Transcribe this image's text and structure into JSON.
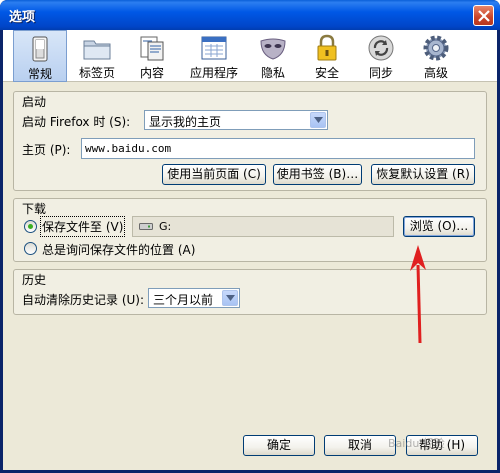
{
  "window": {
    "title": "选项"
  },
  "toolbar": {
    "tabs": [
      {
        "label": "常规",
        "icon": "general-switch-icon"
      },
      {
        "label": "标签页",
        "icon": "tabs-folder-icon"
      },
      {
        "label": "内容",
        "icon": "content-page-icon"
      },
      {
        "label": "应用程序",
        "icon": "applications-window-icon"
      },
      {
        "label": "隐私",
        "icon": "privacy-mask-icon"
      },
      {
        "label": "安全",
        "icon": "security-lock-icon"
      },
      {
        "label": "同步",
        "icon": "sync-arrows-icon"
      },
      {
        "label": "高级",
        "icon": "advanced-gear-icon"
      }
    ],
    "selected": "常规"
  },
  "startup": {
    "group_title": "启动",
    "when_label": "启动 Firefox 时 (S):",
    "when_value": "显示我的主页",
    "homepage_label": "主页 (P):",
    "homepage_value": "www.baidu.com",
    "use_current_btn": "使用当前页面 (C)",
    "use_bookmark_btn": "使用书签 (B)…",
    "restore_default_btn": "恢复默认设置 (R)"
  },
  "downloads": {
    "group_title": "下载",
    "save_to_label": "保存文件至 (V)",
    "save_to_path": "G:",
    "browse_btn": "浏览 (O)…",
    "always_ask_label": "总是询问保存文件的位置 (A)",
    "selected_option": "save_to"
  },
  "history": {
    "group_title": "历史",
    "auto_clear_label": "自动清除历史记录 (U):",
    "auto_clear_value": "三个月以前"
  },
  "footer": {
    "ok_btn": "确定",
    "cancel_btn": "取消",
    "help_btn": "帮助 (H)"
  },
  "annotation": {
    "arrow_color": "#e02020"
  },
  "watermark": "Baidu 经验"
}
